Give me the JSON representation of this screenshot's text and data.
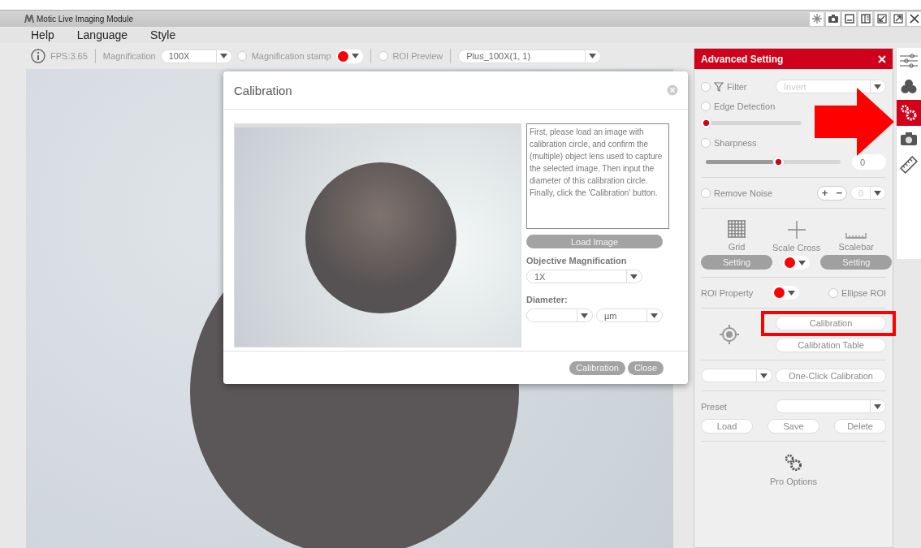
{
  "window": {
    "title": "Motic Live Imaging Module"
  },
  "menu": [
    "Help",
    "Language",
    "Style"
  ],
  "toolbar": {
    "fps": "FPS:3.65",
    "magnification_label": "Magnification",
    "magnification": "100X",
    "stamp": {
      "label": "Magnification stamp",
      "checked": false,
      "color": "#ff0000"
    },
    "roi_preview": {
      "label": "ROI Preview",
      "checked": false
    },
    "preset": "Plus_100X(1, 1)"
  },
  "panel": {
    "title": "Advanced Setting",
    "filter": {
      "label": "Filter",
      "checked": false,
      "value": "Invert"
    },
    "edge": {
      "label": "Edge Detection",
      "checked": false,
      "level": 0
    },
    "sharpness": {
      "label": "Sharpness",
      "checked": false,
      "level": 0.5,
      "value": "0"
    },
    "noise": {
      "label": "Remove Noise",
      "checked": false,
      "plus": "+",
      "minus": "−",
      "value": "0"
    },
    "tools": [
      {
        "kind": "grid",
        "label": "Grid",
        "button": "Setting"
      },
      {
        "kind": "cross",
        "label": "Scale Cross",
        "color": "#ff0000"
      },
      {
        "kind": "scalebar",
        "label": "Scalebar",
        "button": "Setting"
      }
    ],
    "roi": {
      "label": "ROI Property",
      "color": "#ff0000",
      "ellipse": {
        "label": "Ellipse ROI",
        "checked": false
      }
    },
    "calibration": "Calibration",
    "calibration_highlighted": true,
    "calibration_table": "Calibration Table",
    "one_click": "One-Click Calibration",
    "preset": {
      "label": "Preset",
      "buttons": [
        "Load",
        "Save",
        "Delete"
      ]
    },
    "pro_options": "Pro Options"
  },
  "side_tabs": [
    {
      "kind": "sliders",
      "selected": false
    },
    {
      "kind": "colors",
      "selected": false
    },
    {
      "kind": "gears",
      "selected": true
    },
    {
      "kind": "camera",
      "selected": false
    },
    {
      "kind": "ruler",
      "selected": false
    }
  ],
  "dialog": {
    "title": "Calibration",
    "instructions": "First, please load an image with calibration circle, and confirm the (multiple) object lens used to capture the selected image. Then input the diameter of this calibration circle. Finally, click the 'Calibration' button.",
    "load": "Load Image",
    "objective_label": "Objective Magnification",
    "objective": "1X",
    "diameter_label": "Diameter:",
    "unit": "µm",
    "buttons": [
      "Calibration",
      "Close"
    ]
  },
  "annotation": {
    "arrow": true
  }
}
